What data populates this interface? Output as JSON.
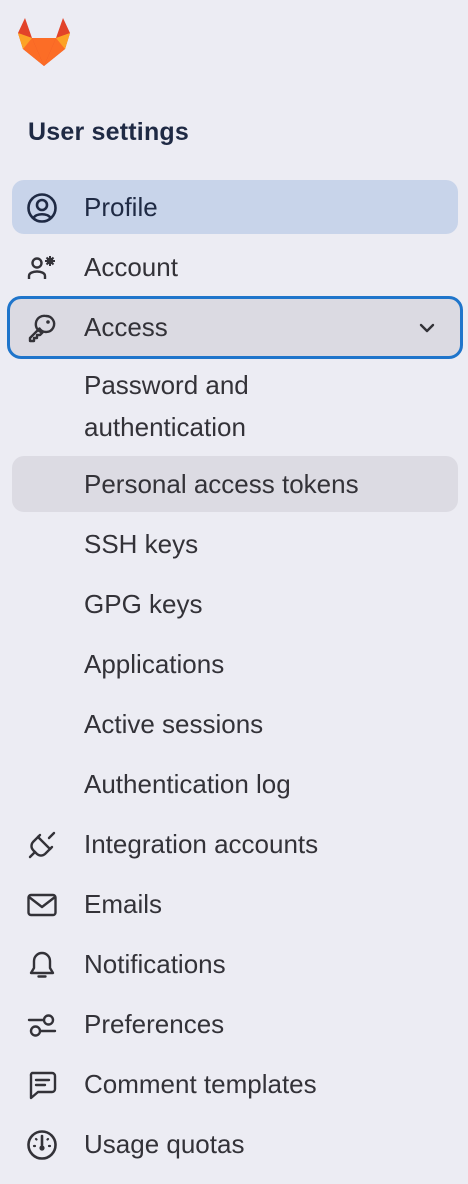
{
  "brand": {
    "logo_icon": "gitlab-tanuki-icon"
  },
  "section_title": "User settings",
  "nav": {
    "profile": {
      "label": "Profile",
      "icon": "user-circle-icon"
    },
    "account": {
      "label": "Account",
      "icon": "user-gear-icon"
    },
    "access": {
      "label": "Access",
      "icon": "key-icon",
      "expanded": true,
      "children": {
        "password": "Password and\nauthentication",
        "password_line1": "Password and",
        "password_line2": "authentication",
        "tokens": "Personal access tokens",
        "ssh": "SSH keys",
        "gpg": "GPG keys",
        "applications": "Applications",
        "sessions": "Active sessions",
        "auth_log": "Authentication log"
      }
    },
    "integrations": {
      "label": "Integration accounts",
      "icon": "plug-icon"
    },
    "emails": {
      "label": "Emails",
      "icon": "envelope-icon"
    },
    "notifications": {
      "label": "Notifications",
      "icon": "bell-icon"
    },
    "preferences": {
      "label": "Preferences",
      "icon": "sliders-icon"
    },
    "comment_templates": {
      "label": "Comment templates",
      "icon": "comment-icon"
    },
    "usage_quotas": {
      "label": "Usage quotas",
      "icon": "dashboard-icon"
    }
  },
  "colors": {
    "background": "#ececf3",
    "active_bg": "#c8d4ea",
    "focus_ring": "#1f75cb",
    "text": "#333238",
    "heading": "#1f2a44"
  }
}
